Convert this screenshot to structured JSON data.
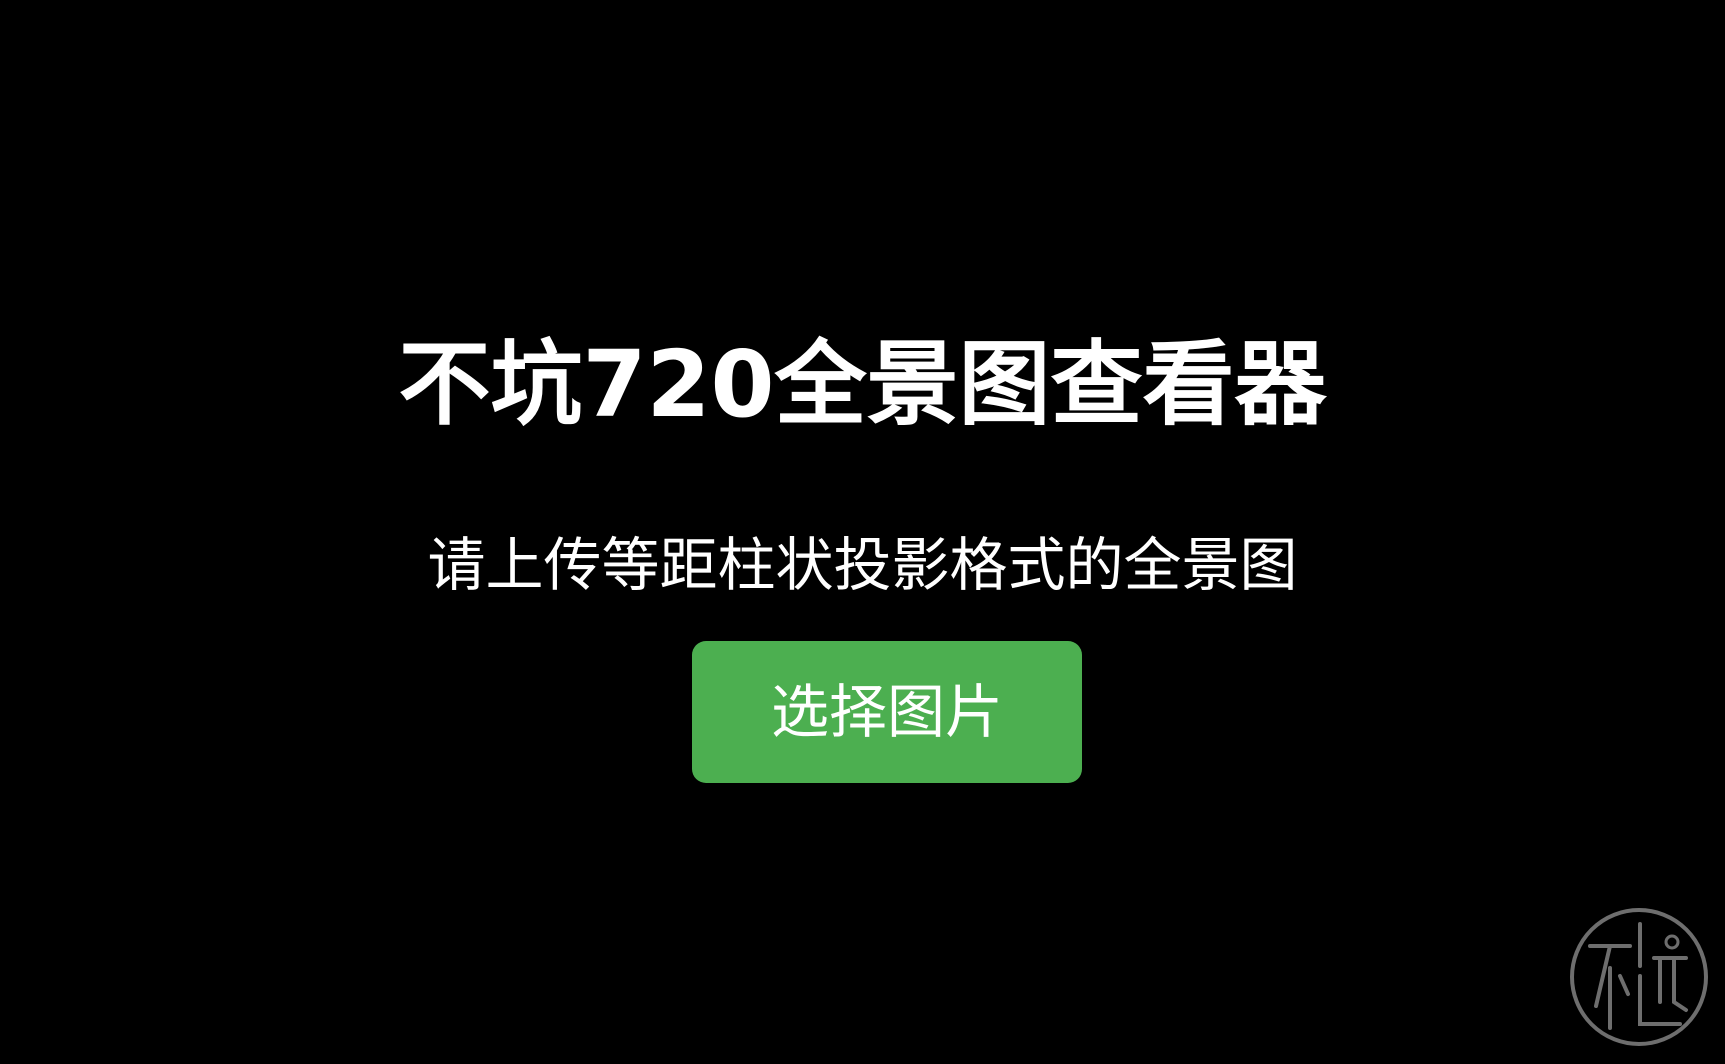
{
  "app": {
    "title": "不坑720全景图查看器",
    "subtitle": "请上传等距柱状投影格式的全景图"
  },
  "upload": {
    "button_label": "选择图片"
  },
  "colors": {
    "background": "#000000",
    "text": "#ffffff",
    "button_background": "#4caf50",
    "logo_stroke": "#6e6e6e"
  },
  "logo": {
    "icon": "brand-seal-icon"
  }
}
